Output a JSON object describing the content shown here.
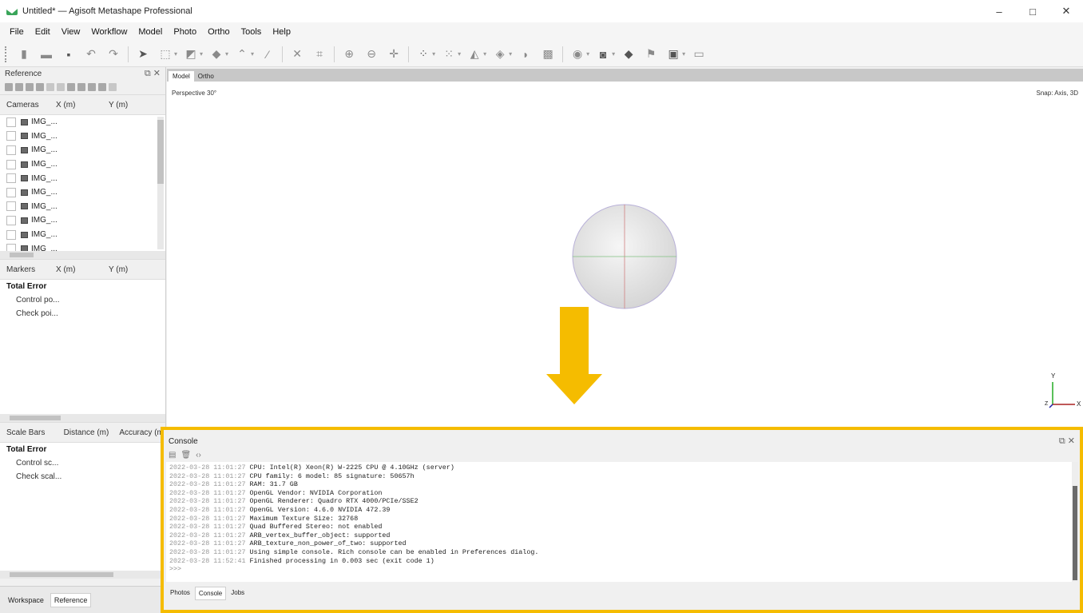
{
  "window": {
    "title": "Untitled* — Agisoft Metashape Professional",
    "minimize": "–",
    "maximize": "□",
    "close": "✕"
  },
  "menu": [
    "File",
    "Edit",
    "View",
    "Workflow",
    "Model",
    "Photo",
    "Ortho",
    "Tools",
    "Help"
  ],
  "reference_panel": {
    "title": "Reference",
    "cameras": {
      "headers": [
        "Cameras",
        "X (m)",
        "Y (m)"
      ],
      "items": [
        "IMG_...",
        "IMG_...",
        "IMG_...",
        "IMG_...",
        "IMG_...",
        "IMG_...",
        "IMG_...",
        "IMG_...",
        "IMG_...",
        "IMG_..."
      ]
    },
    "markers": {
      "headers": [
        "Markers",
        "X (m)",
        "Y (m)"
      ],
      "total": "Total Error",
      "rows": [
        "Control po...",
        "Check poi..."
      ]
    },
    "scalebars": {
      "headers": [
        "Scale Bars",
        "Distance (m)",
        "Accuracy (m"
      ],
      "total": "Total Error",
      "rows": [
        "Control sc...",
        "Check scal..."
      ]
    },
    "tabs": [
      "Workspace",
      "Reference"
    ]
  },
  "view": {
    "tabs": [
      "Model",
      "Ortho"
    ],
    "perspective": "Perspective 30°",
    "snap": "Snap: Axis, 3D",
    "axis_y": "Y",
    "axis_x": "X",
    "axis_z": "Z"
  },
  "console": {
    "title": "Console",
    "lines": [
      {
        "ts": "2022-03-28 11:01:27",
        "msg": "CPU: Intel(R) Xeon(R) W-2225 CPU @ 4.10GHz (server)"
      },
      {
        "ts": "2022-03-28 11:01:27",
        "msg": "CPU family: 6 model: 85 signature: 50657h"
      },
      {
        "ts": "2022-03-28 11:01:27",
        "msg": "RAM: 31.7 GB"
      },
      {
        "ts": "2022-03-28 11:01:27",
        "msg": "OpenGL Vendor: NVIDIA Corporation"
      },
      {
        "ts": "2022-03-28 11:01:27",
        "msg": "OpenGL Renderer: Quadro RTX 4000/PCIe/SSE2"
      },
      {
        "ts": "2022-03-28 11:01:27",
        "msg": "OpenGL Version: 4.6.0 NVIDIA 472.39"
      },
      {
        "ts": "2022-03-28 11:01:27",
        "msg": "Maximum Texture Size: 32768"
      },
      {
        "ts": "2022-03-28 11:01:27",
        "msg": "Quad Buffered Stereo: not enabled"
      },
      {
        "ts": "2022-03-28 11:01:27",
        "msg": "ARB_vertex_buffer_object: supported"
      },
      {
        "ts": "2022-03-28 11:01:27",
        "msg": "ARB_texture_non_power_of_two: supported"
      },
      {
        "ts": "2022-03-28 11:01:27",
        "msg": "Using simple console. Rich console can be enabled in Preferences dialog."
      },
      {
        "ts": "2022-03-28 11:52:41",
        "msg": "Finished processing in 0.003 sec (exit code 1)"
      }
    ],
    "prompt": ">>>",
    "tabs": [
      "Photos",
      "Console",
      "Jobs"
    ]
  },
  "colors": {
    "highlight": "#f5bc00",
    "arrow": "#f5bc00",
    "sphere": "#e4e4e4"
  }
}
